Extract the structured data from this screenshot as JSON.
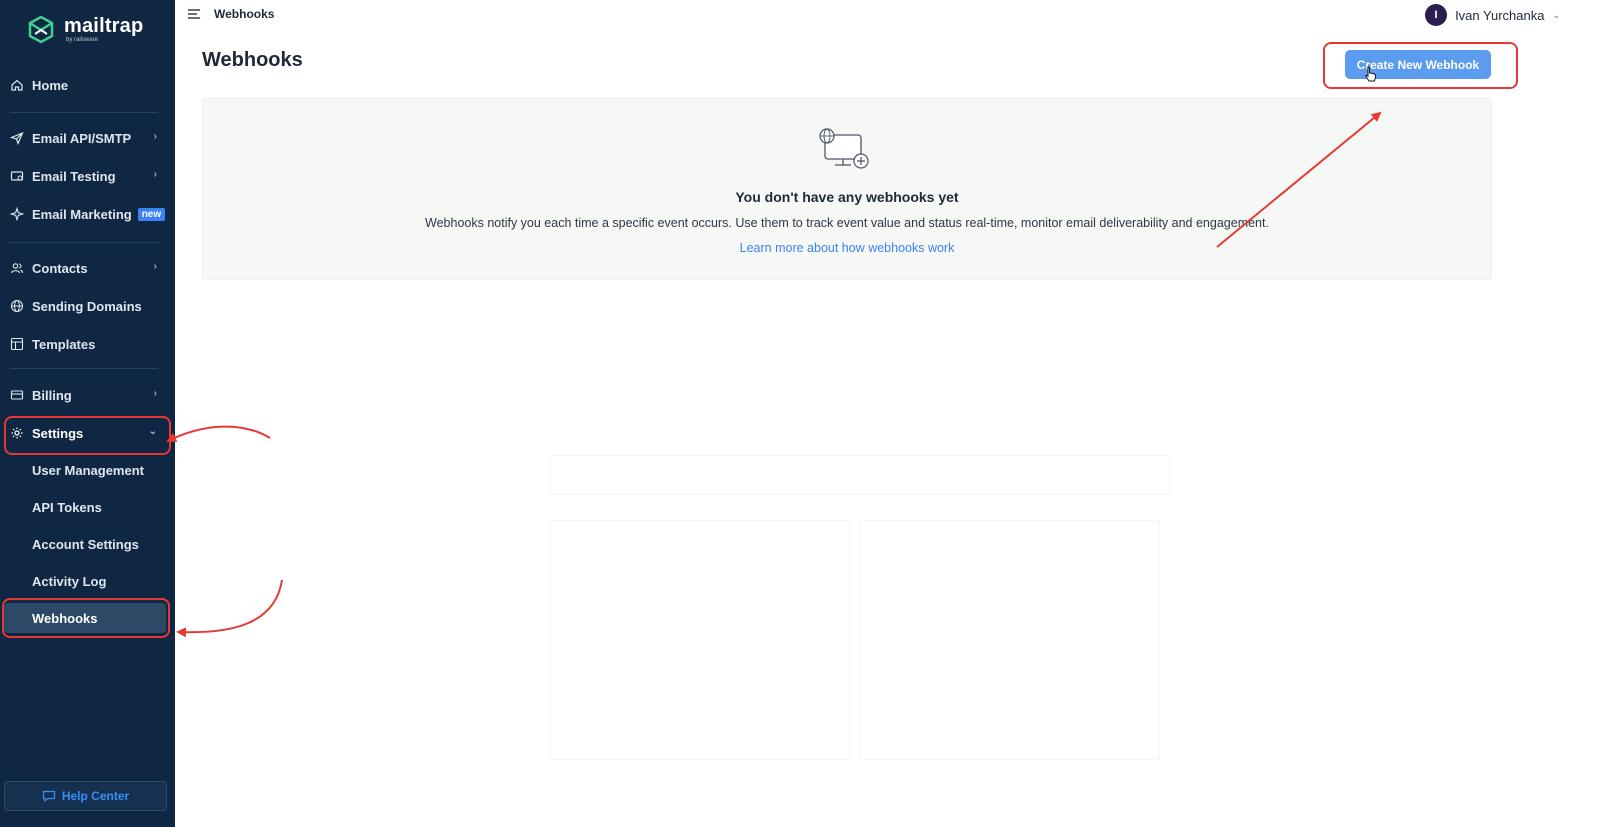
{
  "brand": {
    "name": "mailtrap",
    "sub": "by railsware"
  },
  "topbar": {
    "breadcrumb": "Webhooks",
    "user_initial": "I",
    "user_name": "Ivan Yurchanka"
  },
  "sidebar": {
    "items": [
      {
        "label": "Home",
        "icon": "home-icon"
      },
      {
        "label": "Email API/SMTP",
        "icon": "send-icon"
      },
      {
        "label": "Email Testing",
        "icon": "inbox-icon"
      },
      {
        "label": "Email Marketing",
        "icon": "sparkle-icon",
        "badge": "new"
      },
      {
        "label": "Contacts",
        "icon": "users-icon"
      },
      {
        "label": "Sending Domains",
        "icon": "globe-icon"
      },
      {
        "label": "Templates",
        "icon": "template-icon"
      },
      {
        "label": "Billing",
        "icon": "card-icon"
      },
      {
        "label": "Settings",
        "icon": "gear-icon"
      }
    ],
    "settings_sub": [
      {
        "label": "User Management"
      },
      {
        "label": "API Tokens"
      },
      {
        "label": "Account Settings"
      },
      {
        "label": "Activity Log"
      },
      {
        "label": "Webhooks",
        "active": true
      }
    ],
    "help": "Help Center"
  },
  "main": {
    "title": "Webhooks",
    "create_button": "Create New Webhook",
    "empty": {
      "title": "You don't have any webhooks yet",
      "description": "Webhooks notify you each time a specific event occurs. Use them to track event value and status real-time, monitor email deliverability and engagement.",
      "link": "Learn more about how webhooks work"
    }
  },
  "colors": {
    "sidebar_bg": "#0f2742",
    "accent": "#5b9bf0",
    "link": "#3b82f6",
    "annotation": "#e53935"
  }
}
